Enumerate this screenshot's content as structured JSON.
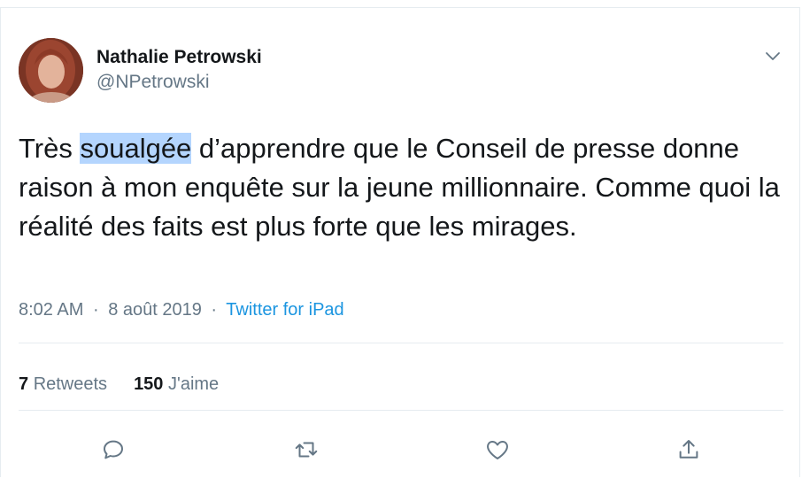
{
  "author": {
    "name": "Nathalie Petrowski",
    "handle": "@NPetrowski"
  },
  "tweet": {
    "text_before": "Très ",
    "text_highlight": "soualgée",
    "text_after": " d’apprendre que le Conseil de presse donne raison à mon enquête sur la jeune millionnaire. Comme quoi la réalité des faits est plus forte que les mirages."
  },
  "meta": {
    "time": "8:02 AM",
    "separator": "·",
    "date": "8 août 2019",
    "source": "Twitter for iPad"
  },
  "stats": {
    "retweets_count": "7",
    "retweets_label": "Retweets",
    "likes_count": "150",
    "likes_label": "J'aime"
  },
  "icons": {
    "more": "chevron-down-icon",
    "reply": "reply-icon",
    "retweet": "retweet-icon",
    "like": "heart-icon",
    "share": "share-icon"
  },
  "colors": {
    "text": "#14171a",
    "secondary": "#657786",
    "link": "#1b95e0",
    "highlight": "#b4d5fe",
    "divider": "#e6ecf0"
  }
}
